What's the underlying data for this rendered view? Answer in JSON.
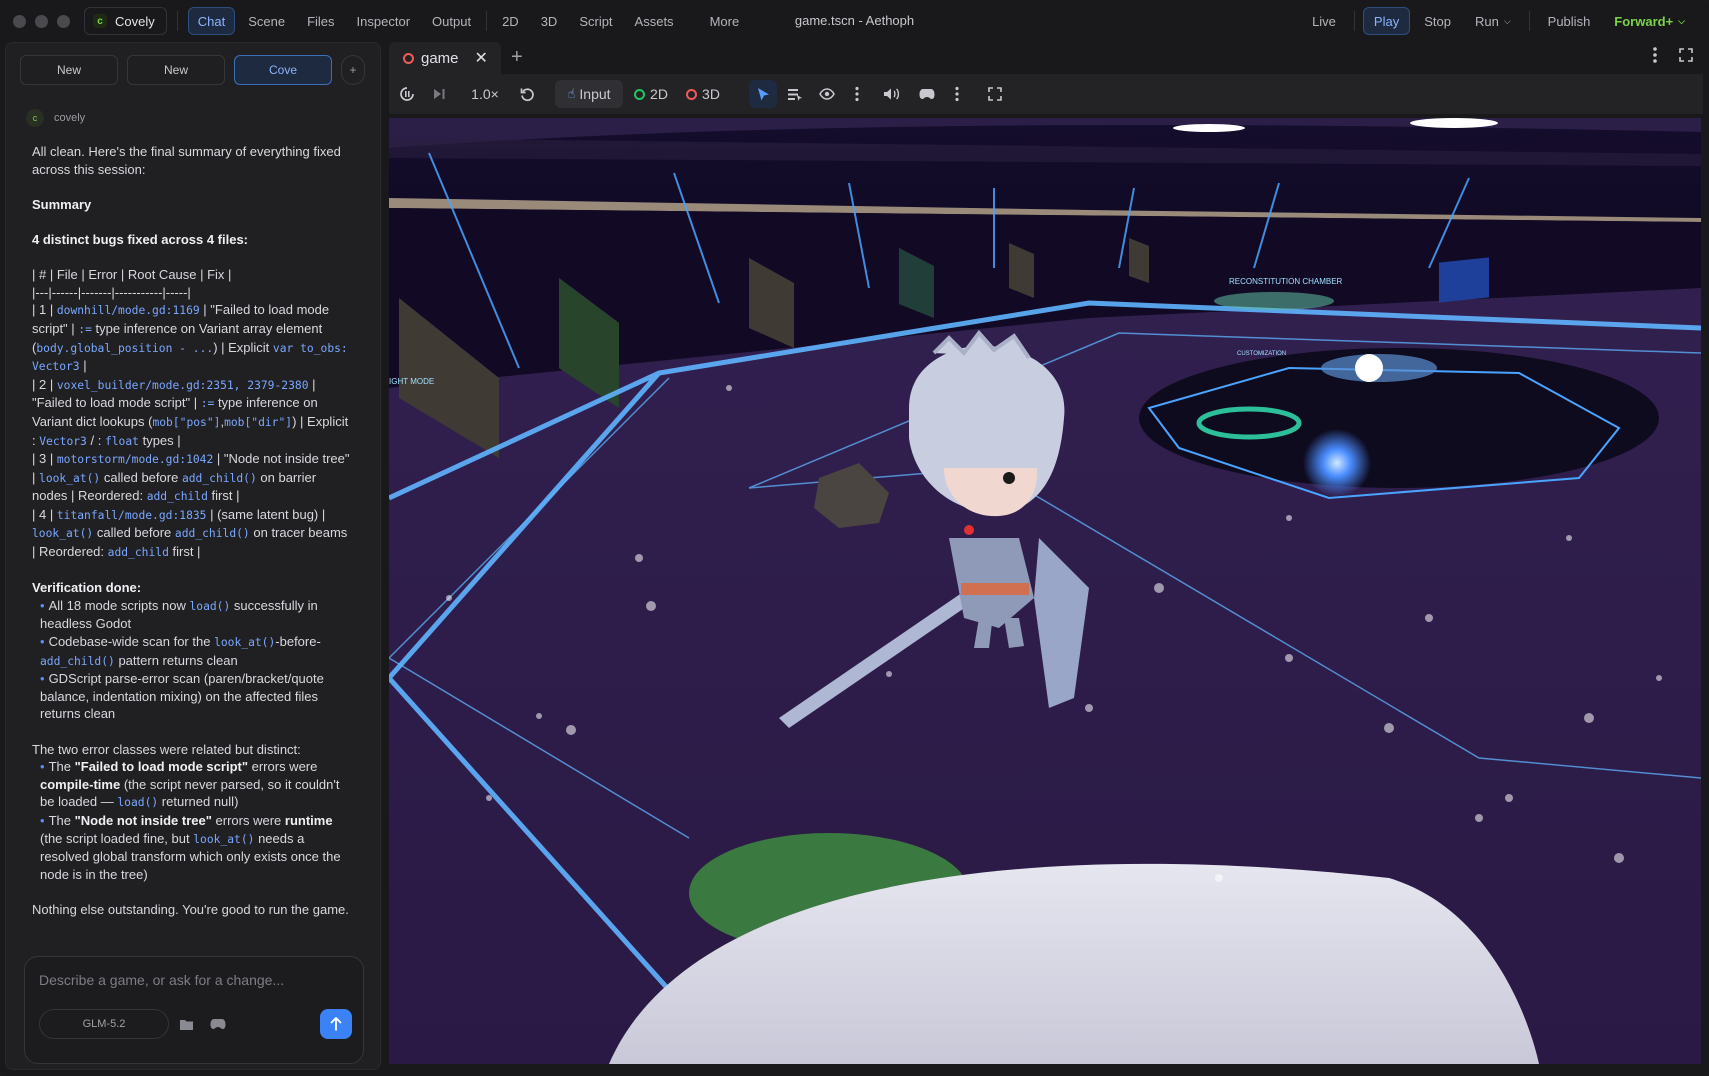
{
  "app": {
    "name": "Covely",
    "logo_letter": "c",
    "window_title": "game.tscn - Aethoph"
  },
  "nav": {
    "chat": "Chat",
    "scene": "Scene",
    "files": "Files",
    "inspector": "Inspector",
    "output": "Output",
    "view_2d": "2D",
    "view_3d": "3D",
    "script": "Script",
    "assets": "Assets",
    "more": "More"
  },
  "right_nav": {
    "live": "Live",
    "play": "Play",
    "stop": "Stop",
    "run": "Run",
    "publish": "Publish",
    "renderer": "Forward+"
  },
  "chat_tabs": {
    "tab1": "New",
    "tab2": "New",
    "tab3": "Cove",
    "add": "+"
  },
  "message": {
    "author": "covely",
    "author_initial": "c",
    "intro": "All clean. Here's the final summary of everything fixed across this session:",
    "summary_heading": "Summary",
    "bugs_heading": "4 distinct bugs fixed across 4 files:",
    "table_header": "| # | File | Error | Root Cause | Fix |",
    "table_sep": "|---|------|-------|-----------|-----|",
    "row1_a": "| 1 |",
    "row1_file": "downhill/mode.gd:1169",
    "row1_b": "| \"Failed to load mode script\" |",
    "row1_c": ":=",
    "row1_d": "type inference on Variant array element (",
    "row1_e": "body.global_position - ...",
    "row1_f": ") | Explicit",
    "row1_g": "var to_obs: Vector3",
    "row1_h": "|",
    "row2_a": "| 2 |",
    "row2_file": "voxel_builder/mode.gd:2351, 2379-2380",
    "row2_b": "|",
    "row2_c": "\"Failed to load mode script\" |",
    "row2_d": ":=",
    "row2_e": "type inference on Variant dict lookups (",
    "row2_f": "mob[\"pos\"]",
    "row2_g": ",",
    "row2_h": "mob[\"dir\"]",
    "row2_i": ") | Explicit :",
    "row2_j": "Vector3",
    "row2_k": "/ :",
    "row2_l": "float",
    "row2_m": "types |",
    "row3_a": "| 3 |",
    "row3_file": "motorstorm/mode.gd:1042",
    "row3_b": "| \"Node not inside tree\" |",
    "row3_c": "look_at()",
    "row3_d": "called before",
    "row3_e": "add_child()",
    "row3_f": "on barrier nodes | Reordered:",
    "row3_g": "add_child",
    "row3_h": "first |",
    "row4_a": "| 4 |",
    "row4_file": "titanfall/mode.gd:1835",
    "row4_b": "| (same latent bug) |",
    "row4_c": "look_at()",
    "row4_d": "called before",
    "row4_e": "add_child()",
    "row4_f": "on tracer beams | Reordered:",
    "row4_g": "add_child",
    "row4_h": "first |",
    "verif_heading": "Verification done:",
    "v1_a": "All 18 mode scripts now",
    "v1_b": "load()",
    "v1_c": "successfully in headless Godot",
    "v2_a": "Codebase-wide scan for the",
    "v2_b": "look_at()",
    "v2_c": "-before-",
    "v2_d": "add_child()",
    "v2_e": "pattern returns clean",
    "v3": "GDScript parse-error scan (paren/bracket/quote balance, indentation mixing) on the affected files returns clean",
    "classes_intro": "The two error classes were related but distinct:",
    "c1_a": "The",
    "c1_b": "\"Failed to load mode script\"",
    "c1_c": "errors were",
    "c1_d": "compile-time",
    "c1_e": "(the script never parsed, so it couldn't be loaded —",
    "c1_f": "load()",
    "c1_g": "returned null)",
    "c2_a": "The",
    "c2_b": "\"Node not inside tree\"",
    "c2_c": "errors were",
    "c2_d": "runtime",
    "c2_e": "(the script loaded fine, but",
    "c2_f": "look_at()",
    "c2_g": "needs a resolved global transform which only exists once the node is in the tree)",
    "closing": "Nothing else outstanding. You're good to run the game."
  },
  "composer": {
    "placeholder": "Describe a game, or ask for a change...",
    "model": "GLM-5.2"
  },
  "game_tab": {
    "label": "game"
  },
  "toolbar": {
    "speed": "1.0×",
    "input": "Input",
    "mode_2d": "2D",
    "mode_3d": "3D"
  },
  "scene_labels": {
    "reconstitution": "RECONSTITUTION CHAMBER",
    "customization": "CUSTOMIZATION",
    "right_mode": "IGHT MODE"
  },
  "colors": {
    "accent": "#3b82f6",
    "brand": "#7bd34a",
    "ring_red": "#f05a5a",
    "ring_green": "#22c55e",
    "floor": "#2a1a46",
    "neon": "#5fb4ff"
  }
}
